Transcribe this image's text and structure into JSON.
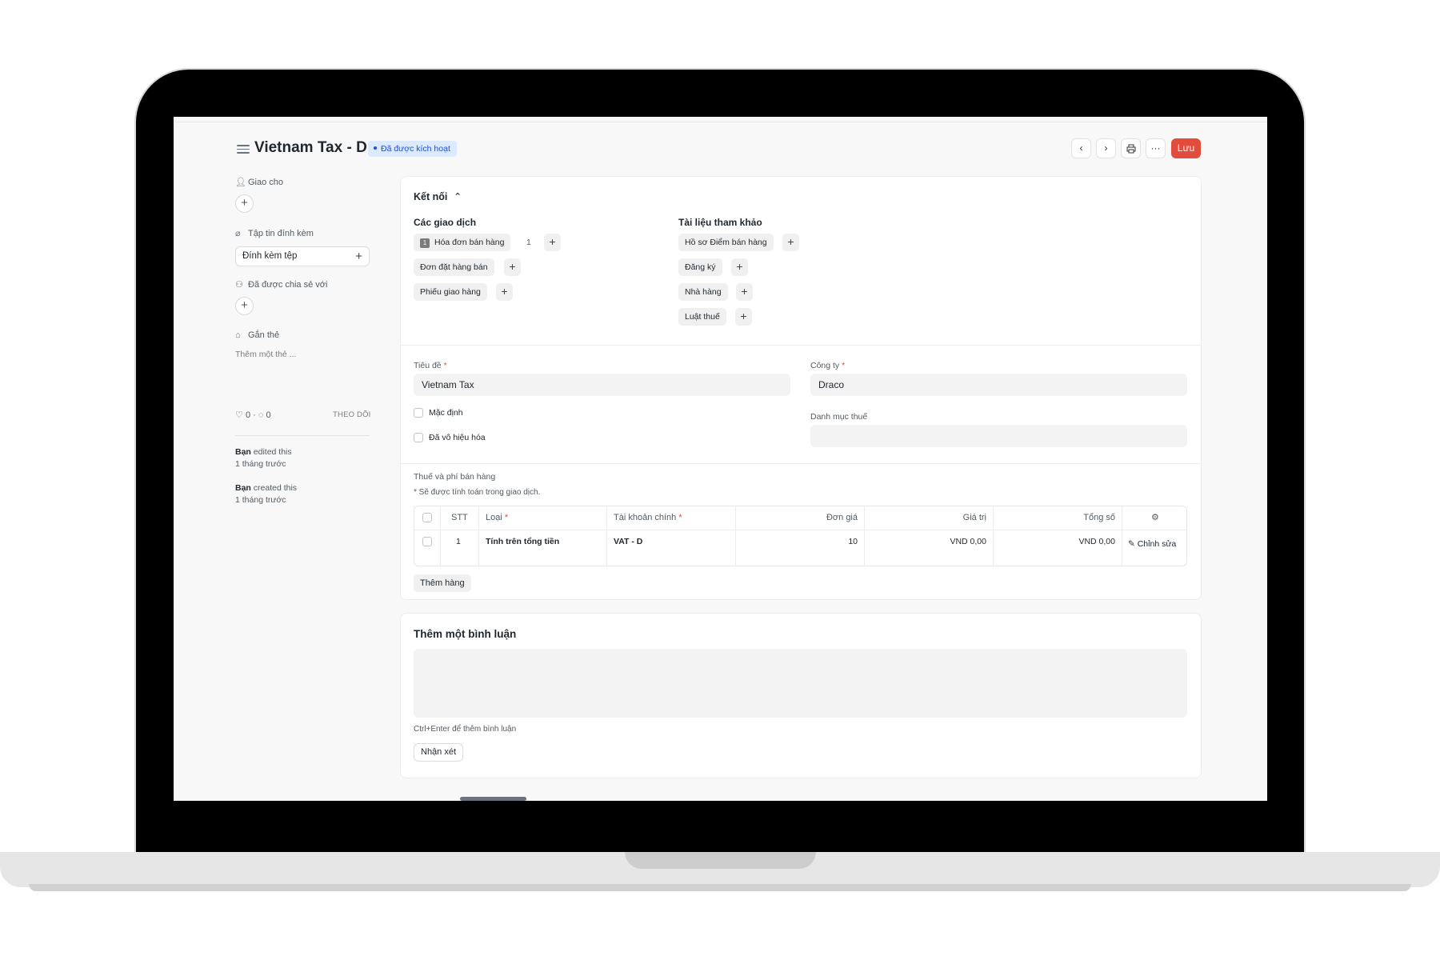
{
  "header": {
    "title": "Vietnam Tax - D",
    "status_badge": "Đã được kích hoạt",
    "save_label": "Lưu"
  },
  "sidebar": {
    "assign_label": "Giao cho",
    "attachments_label": "Tập tin đính kèm",
    "attach_button": "Đính kèm tệp",
    "shared_label": "Đã được chia sẻ với",
    "tags_label": "Gắn thẻ",
    "add_tag_placeholder": "Thêm một thẻ ...",
    "likes": "0",
    "comments": "0",
    "follow_label": "THEO DÕI",
    "activity": [
      {
        "user": "Bạn",
        "action": "edited this",
        "time": "1 tháng trước"
      },
      {
        "user": "Bạn",
        "action": "created this",
        "time": "1 tháng trước"
      }
    ]
  },
  "connections": {
    "section_title": "Kết nối",
    "transactions_title": "Các giao dịch",
    "references_title": "Tài liệu tham khảo",
    "transactions": [
      {
        "label": "Hóa đơn bán hàng",
        "badge": "1",
        "count": "1"
      },
      {
        "label": "Đơn đặt hàng bán"
      },
      {
        "label": "Phiếu giao hàng"
      }
    ],
    "references": [
      {
        "label": "Hồ sơ Điểm bán hàng"
      },
      {
        "label": "Đăng ký"
      },
      {
        "label": "Nhà hàng"
      },
      {
        "label": "Luật thuế"
      }
    ]
  },
  "form": {
    "title_label": "Tiêu đề",
    "title_value": "Vietnam Tax",
    "company_label": "Công ty",
    "company_value": "Draco",
    "default_label": "Mặc định",
    "disabled_label": "Đã vô hiệu hóa",
    "tax_category_label": "Danh mục thuế",
    "tax_category_value": "",
    "taxes_label": "Thuế và phí bán hàng",
    "taxes_note": "* Sẽ được tính toán trong giao dịch."
  },
  "table": {
    "headers": {
      "no": "STT",
      "type": "Loại",
      "account": "Tài khoản chính",
      "rate": "Đơn giá",
      "amount": "Giá trị",
      "total": "Tổng số"
    },
    "rows": [
      {
        "no": "1",
        "type": "Tính trên tổng tiền",
        "account": "VAT - D",
        "rate": "10",
        "amount": "VND 0,00",
        "total": "VND 0,00",
        "edit": "Chỉnh sửa"
      }
    ],
    "add_row": "Thêm hàng"
  },
  "comment": {
    "title": "Thêm một bình luận",
    "hint": "Ctrl+Enter để thêm bình luận",
    "submit": "Nhận xét"
  },
  "colors": {
    "primary": "#e24c3c",
    "badge_bg": "#dbeafe",
    "badge_text": "#1d4ed8"
  }
}
